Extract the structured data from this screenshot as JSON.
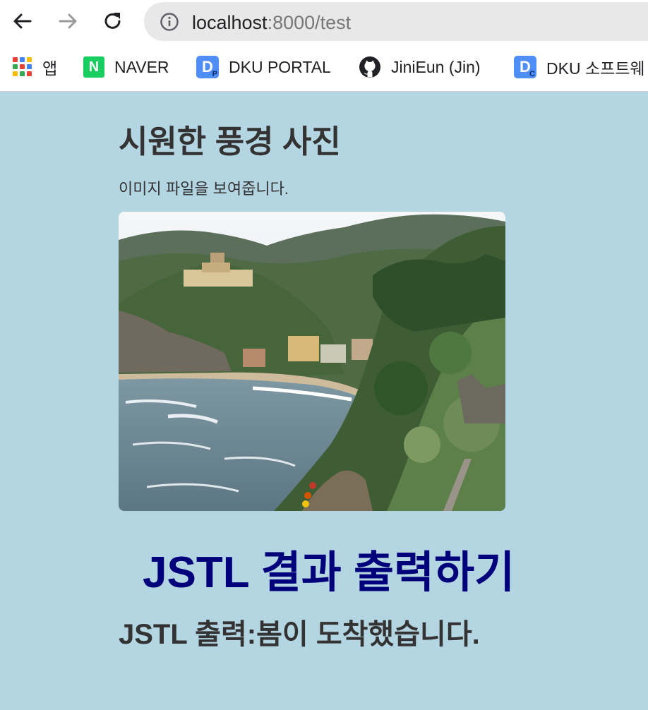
{
  "browser": {
    "url_host": "localhost",
    "url_rest": ":8000/test"
  },
  "bookmarks": [
    {
      "label": "앱"
    },
    {
      "label": "NAVER",
      "logo_text": "N"
    },
    {
      "label": "DKU PORTAL",
      "logo_text": "D",
      "logo_sub": "P"
    },
    {
      "label": "JiniEun (Jin)"
    },
    {
      "label": "DKU 소프트웨",
      "logo_text": "D",
      "logo_sub": "C"
    }
  ],
  "page": {
    "title": "시원한 풍경 사진",
    "description": "이미지 파일을 보여줍니다.",
    "jstl_heading": "JSTL 결과 출력하기",
    "jstl_output": "JSTL 출력:봄이 도착했습니다."
  },
  "colors": {
    "background": "#b4d5e2",
    "heading_blue": "#00007a",
    "text_dark": "#333333"
  }
}
